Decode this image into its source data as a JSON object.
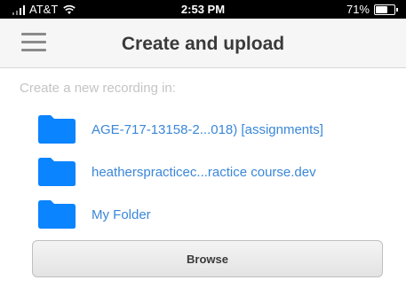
{
  "status_bar": {
    "carrier": "AT&T",
    "time": "2:53 PM",
    "battery_percent": "71%",
    "battery_level": 0.71,
    "icons": [
      "signal-icon",
      "wifi-icon",
      "battery-icon"
    ]
  },
  "nav": {
    "title": "Create and upload",
    "menu_icon": "hamburger-icon"
  },
  "main": {
    "section_label": "Create a new recording in:",
    "folders": [
      {
        "label": "AGE-717-13158-2...018) [assignments]",
        "icon": "folder-icon"
      },
      {
        "label": "heatherspracticec...ractice course.dev",
        "icon": "folder-icon"
      },
      {
        "label": "My Folder",
        "icon": "folder-icon"
      }
    ],
    "browse_label": "Browse"
  },
  "colors": {
    "folder": "#0a84ff",
    "link_text": "#3a87d8",
    "label_gray": "#c4c4c4",
    "status_bar_bg": "#000000"
  }
}
